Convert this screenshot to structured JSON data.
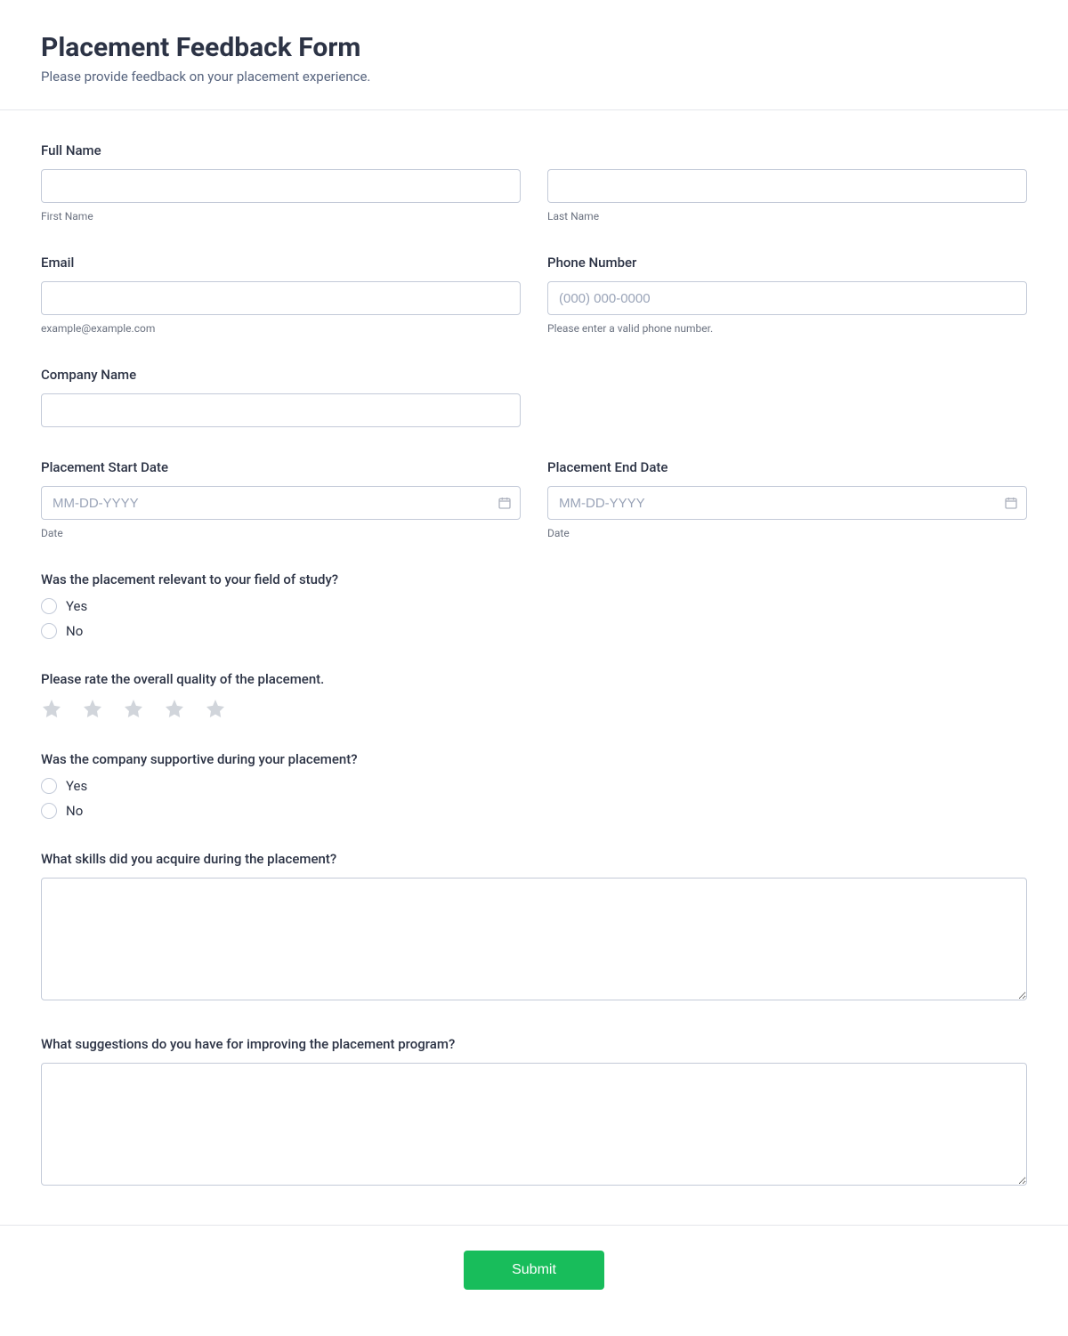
{
  "header": {
    "title": "Placement Feedback Form",
    "subtitle": "Please provide feedback on your placement experience."
  },
  "fields": {
    "fullName": {
      "label": "Full Name",
      "firstSub": "First Name",
      "lastSub": "Last Name"
    },
    "email": {
      "label": "Email",
      "sub": "example@example.com"
    },
    "phone": {
      "label": "Phone Number",
      "placeholder": "(000) 000-0000",
      "sub": "Please enter a valid phone number."
    },
    "company": {
      "label": "Company Name"
    },
    "startDate": {
      "label": "Placement Start Date",
      "placeholder": "MM-DD-YYYY",
      "sub": "Date"
    },
    "endDate": {
      "label": "Placement End Date",
      "placeholder": "MM-DD-YYYY",
      "sub": "Date"
    },
    "relevant": {
      "label": "Was the placement relevant to your field of study?",
      "optYes": "Yes",
      "optNo": "No"
    },
    "quality": {
      "label": "Please rate the overall quality of the placement."
    },
    "supportive": {
      "label": "Was the company supportive during your placement?",
      "optYes": "Yes",
      "optNo": "No"
    },
    "skills": {
      "label": "What skills did you acquire during the placement?"
    },
    "suggestions": {
      "label": "What suggestions do you have for improving the placement program?"
    }
  },
  "footer": {
    "submit": "Submit"
  }
}
